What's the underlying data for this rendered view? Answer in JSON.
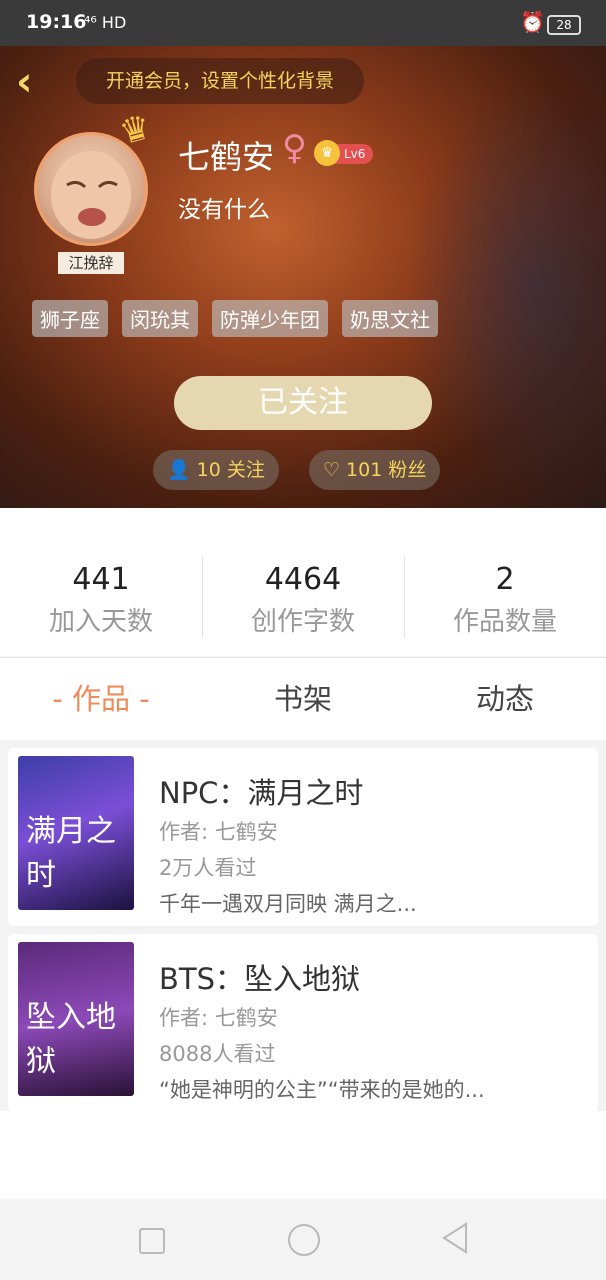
{
  "status_bar": {
    "time": "19:16",
    "signal": "⁴⁶ HD",
    "battery": "28"
  },
  "header": {
    "vip_banner": "开通会员，设置个性化背景"
  },
  "profile": {
    "username": "七鹤安",
    "gender_symbol": "♀",
    "level": "Lv6",
    "bio": "没有什么",
    "avatar_tag": "江挽辞",
    "tags": [
      "狮子座",
      "闵玧其",
      "防弹少年团",
      "奶思文社"
    ],
    "follow_button": "已关注",
    "following": "10 关注",
    "fans": "101 粉丝"
  },
  "stats": [
    {
      "value": "441",
      "label": "加入天数"
    },
    {
      "value": "4464",
      "label": "创作字数"
    },
    {
      "value": "2",
      "label": "作品数量"
    }
  ],
  "tabs": [
    "- 作品 -",
    "书架",
    "动态"
  ],
  "works": [
    {
      "title": "NPC：满月之时",
      "author": "作者: 七鹤安",
      "views": "2万人看过",
      "desc": "千年一遇双月同映 满月之...",
      "cover_text": "满月之时"
    },
    {
      "title": "BTS：坠入地狱",
      "author": "作者: 七鹤安",
      "views": "8088人看过",
      "desc": "“她是神明的公主”“带来的是她的...",
      "cover_text": "坠入地狱"
    }
  ],
  "colors": {
    "accent": "#ef8a5a",
    "gold": "#f5d45c",
    "follow_btn": "#e5d8b1"
  }
}
